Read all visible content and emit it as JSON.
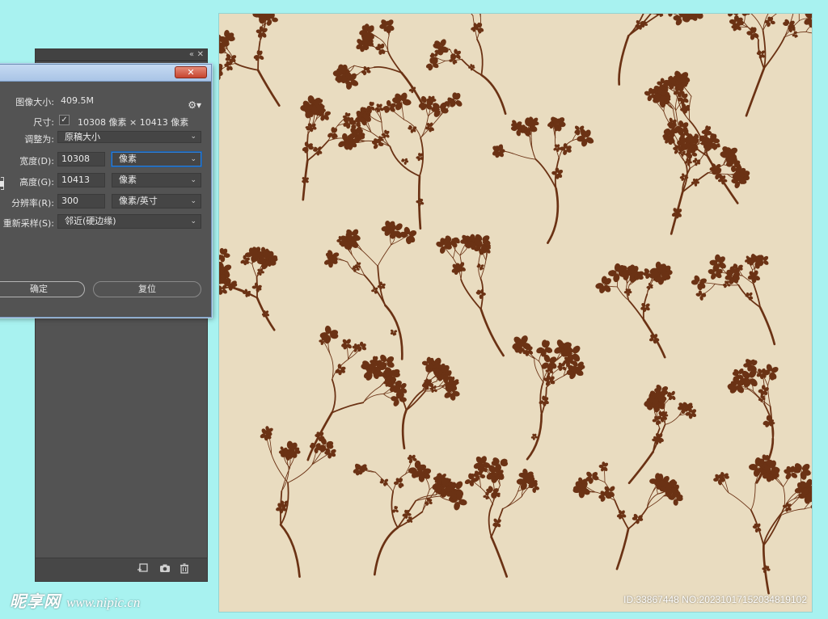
{
  "dialog": {
    "close_glyph": "✕",
    "image_size_label": "图像大小:",
    "image_size_value": "409.5M",
    "gear_icon": "gear-icon",
    "dimensions_label": "尺寸:",
    "dimensions_value": "10308 像素 × 10413 像素",
    "fit_to_label": "调整为:",
    "fit_to_value": "原稿大小",
    "width_label": "宽度(D):",
    "width_value": "10308",
    "width_unit": "像素",
    "height_label": "高度(G):",
    "height_value": "10413",
    "height_unit": "像素",
    "resolution_label": "分辨率(R):",
    "resolution_value": "300",
    "resolution_unit": "像素/英寸",
    "resample_label": "重新采样(S):",
    "resample_value": "邻近(硬边缘)",
    "ok_label": "确定",
    "reset_label": "复位"
  },
  "side_panel": {
    "collapse_glyph": "«",
    "close_glyph": "✕",
    "icons": [
      "new-layer-icon",
      "camera-icon",
      "trash-icon"
    ]
  },
  "canvas": {
    "background_color": "#e9dcc0",
    "pattern_color": "#6b3214",
    "image_id": "ID:33867448 NO:20231017152034819102"
  },
  "watermark": {
    "logo": "昵享网",
    "url": "www.nipic.cn"
  }
}
